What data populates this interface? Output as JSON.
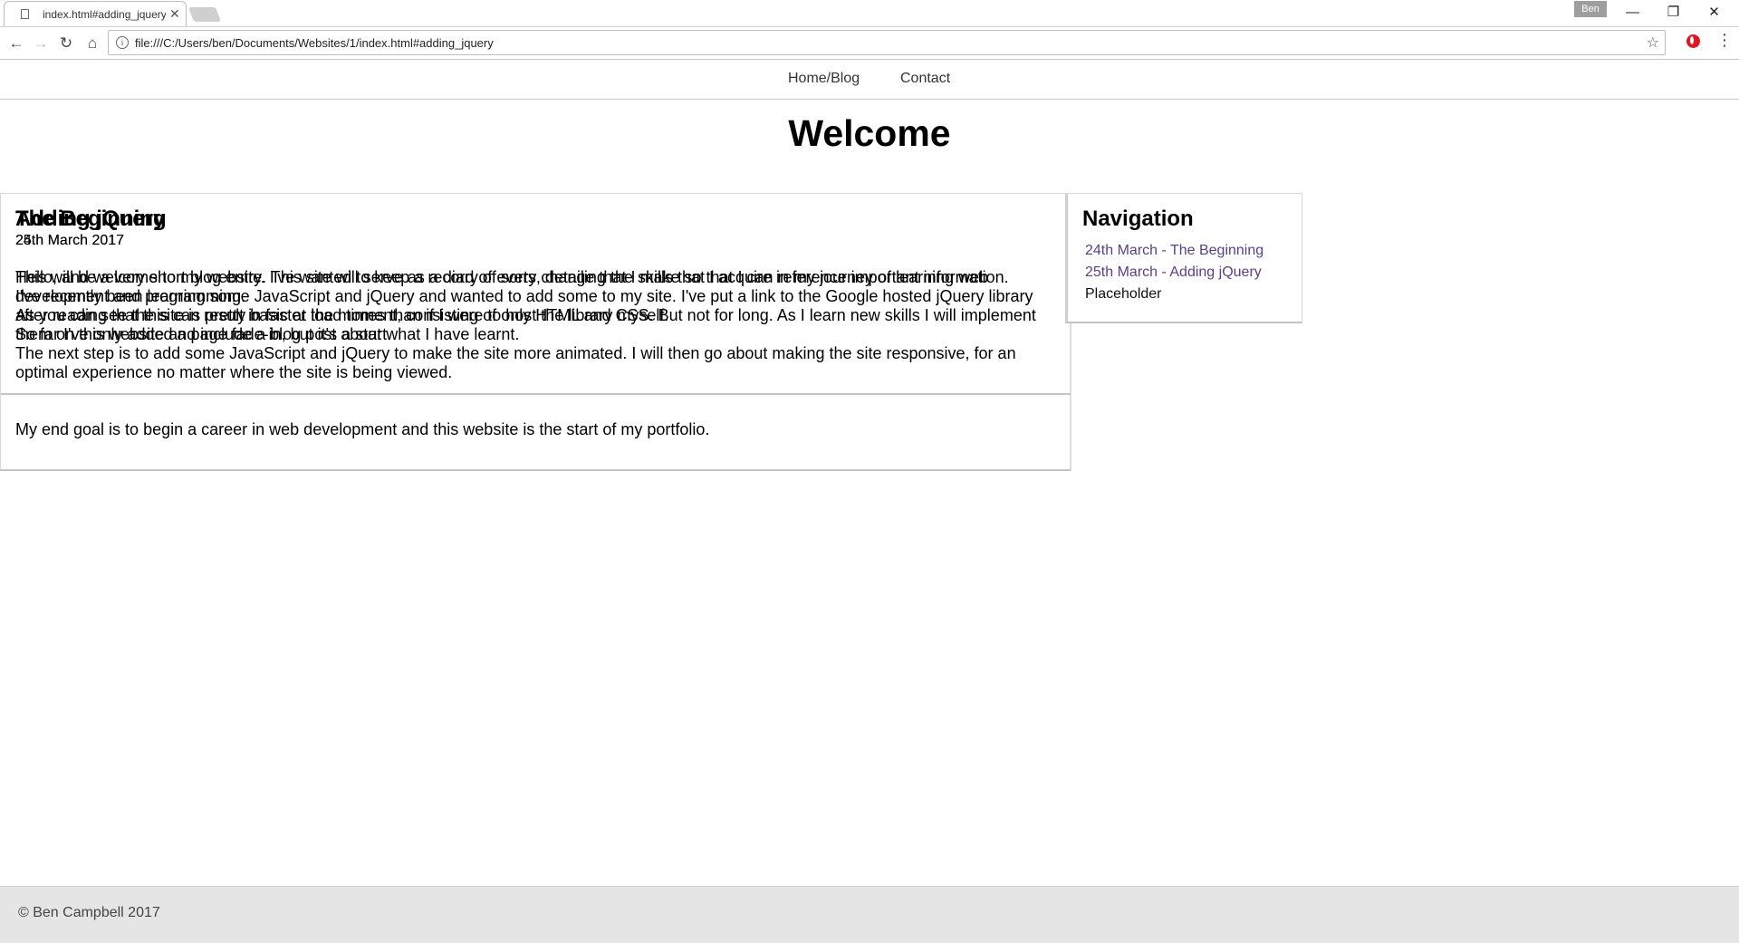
{
  "browser": {
    "tab_title": "index.html#adding_jquery",
    "tab_close": "✕",
    "profile_name": "Ben",
    "url": "file:///C:/Users/ben/Documents/Websites/1/index.html#adding_jquery",
    "window_controls": {
      "minimize": "—",
      "restore": "❐",
      "close": "✕"
    },
    "nav_icons": {
      "back": "←",
      "forward": "→",
      "reload": "↻",
      "home": "⌂",
      "info": "i",
      "bookmark": "☆",
      "menu": "⋮"
    },
    "accent_color": "#e0171f"
  },
  "site": {
    "nav": [
      "Home/Blog",
      "Contact"
    ],
    "heading": "Welcome",
    "posts": [
      {
        "title": "The Beginning",
        "date": "24th March 2017",
        "paragraphs": [
          "Hello, and welcome to my website. This site will serve as a diary of sorts, detailing the skills that I acquire in my journey of learning web development and programming.",
          "As you can see the site is pretty basic at the moment, consisting of only HTML and CSS. But not for long. As I learn new skills I will implement them on this website and include a blog post about what I have learnt.",
          "The next step is to add some JavaScript and jQuery to make the site more animated. I will then go about making the site responsive, for an optimal experience no matter where the site is being viewed.",
          "",
          "My end goal is to begin a career in web development and this website is the start of my portfolio."
        ]
      },
      {
        "title": "Adding jQuery",
        "date": "25th March 2017",
        "paragraphs": [
          "This will be a very short blog entry. I've wanted to keep a record of every change that I make so that I can reference important information.",
          "I've recently been learning some JavaScript and jQuery and wanted to add some to my site. I've put a link to the Google hosted jQuery library after reading that this can result in faster load times than if I were to host the library myself.",
          "So far I've only added a page fade-in, but it's a start."
        ]
      }
    ],
    "sidebar": {
      "title": "Navigation",
      "links": [
        "24th March - The Beginning",
        "25th March - Adding jQuery"
      ],
      "placeholder": "Placeholder",
      "link_color": "#5a3f8a"
    },
    "footer": "© Ben Campbell 2017"
  }
}
